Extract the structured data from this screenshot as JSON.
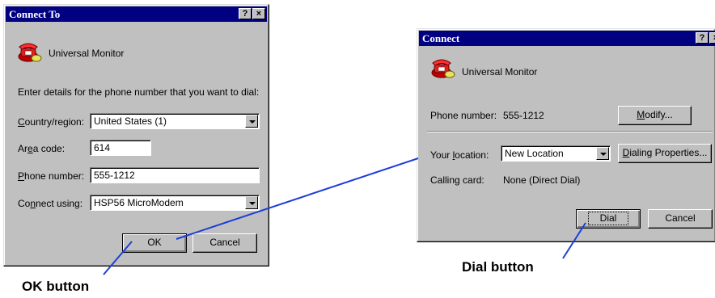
{
  "connect_to": {
    "title": "Connect To",
    "app_name": "Universal Monitor",
    "instructions": "Enter details for the phone number that you want to dial:",
    "country_label": "Country/region:",
    "country_value": "United States (1)",
    "area_label": "Area code:",
    "area_value": "614",
    "phone_label": "Phone number:",
    "phone_value": "555-1212",
    "connect_label": "Connect using:",
    "connect_value": "HSP56 MicroModem",
    "ok_label": "OK",
    "cancel_label": "Cancel"
  },
  "connect": {
    "title": "Connect",
    "app_name": "Universal Monitor",
    "phone_label": "Phone number:",
    "phone_value": "555-1212",
    "modify_label": "Modify...",
    "location_label": "Your location:",
    "location_value": "New Location",
    "dialing_props_label": "Dialing Properties...",
    "calling_card_label": "Calling card:",
    "calling_card_value": "None (Direct Dial)",
    "dial_label": "Dial",
    "cancel_label": "Cancel"
  },
  "annotations": {
    "ok_callout": "OK button",
    "dial_callout": "Dial button",
    "line_color": "#1a3fd6"
  },
  "titlebar_buttons": {
    "help": "?",
    "close": "×"
  },
  "colors": {
    "titlebar": "#000080",
    "face": "#c0c0c0"
  }
}
